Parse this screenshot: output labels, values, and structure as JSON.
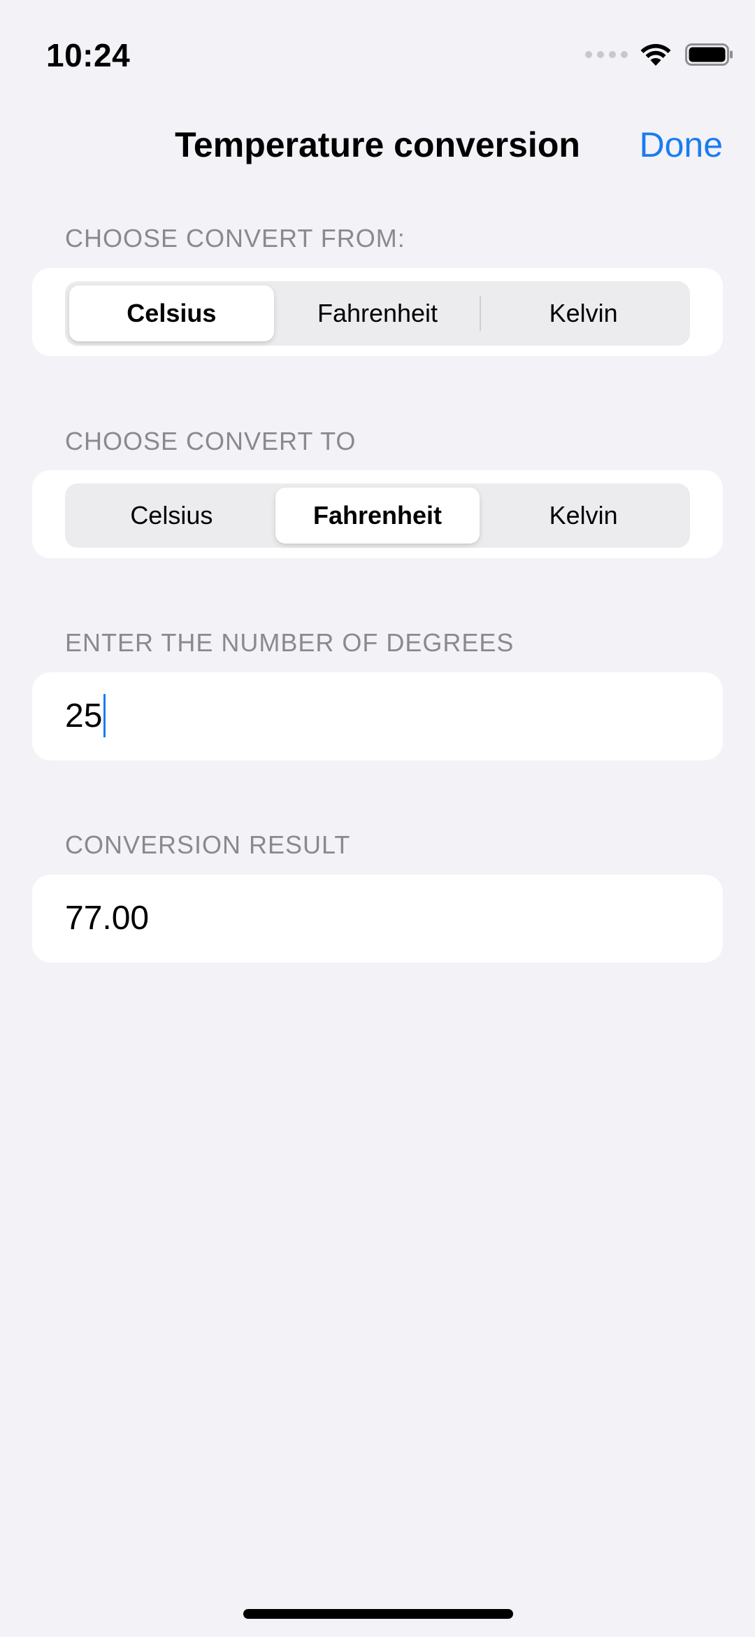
{
  "status_bar": {
    "time": "10:24",
    "icons": [
      "cellular-dots-icon",
      "wifi-icon",
      "battery-icon"
    ]
  },
  "nav": {
    "title": "Temperature conversion",
    "done_label": "Done"
  },
  "accent_color": "#1a7cf0",
  "convert_from": {
    "label": "CHOOSE CONVERT FROM:",
    "options": [
      "Celsius",
      "Fahrenheit",
      "Kelvin"
    ],
    "selected": "Celsius"
  },
  "convert_to": {
    "label": "CHOOSE CONVERT TO",
    "options": [
      "Celsius",
      "Fahrenheit",
      "Kelvin"
    ],
    "selected": "Fahrenheit"
  },
  "degrees": {
    "label": "ENTER THE NUMBER OF DEGREES",
    "value": "25"
  },
  "result": {
    "label": "CONVERSION RESULT",
    "value": "77.00"
  }
}
